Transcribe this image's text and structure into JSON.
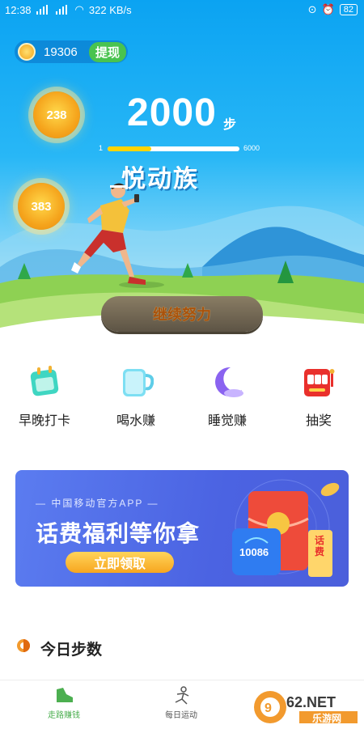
{
  "status_bar": {
    "time": "12:38",
    "net_speed": "322 KB/s",
    "battery": "82"
  },
  "header": {
    "coins": "19306",
    "withdraw_label": "提现"
  },
  "bubbles": [
    {
      "value": "238"
    },
    {
      "value": "383"
    }
  ],
  "steps": {
    "count": "2000",
    "unit": "步",
    "progress_min": "1",
    "progress_max": "6000",
    "progress_value": 2000
  },
  "brand_name": "悦动族",
  "continue_button": "继续努力",
  "quick_actions": [
    {
      "label": "早晚打卡",
      "icon": "calendar-icon"
    },
    {
      "label": "喝水赚",
      "icon": "cup-icon"
    },
    {
      "label": "睡觉赚",
      "icon": "moon-icon"
    },
    {
      "label": "抽奖",
      "icon": "slot-machine-icon"
    }
  ],
  "banner": {
    "subtitle": "— 中国移动官方APP —",
    "title": "话费福利等你拿",
    "button": "立即领取",
    "card_number": "10086",
    "ticket_text": "话费"
  },
  "section_title": "今日步数",
  "bottom_nav": [
    {
      "label": "走路赚钱",
      "icon": "shoe-icon",
      "active": true
    },
    {
      "label": "每日运动",
      "icon": "running-icon",
      "active": false
    }
  ],
  "watermark": {
    "brand": "962.NET",
    "sub": "乐游网"
  },
  "colors": {
    "sky": "#0ba3f2",
    "accent_green": "#49c34f",
    "nav_active": "#4caf50",
    "banner": "#4b63e2"
  }
}
